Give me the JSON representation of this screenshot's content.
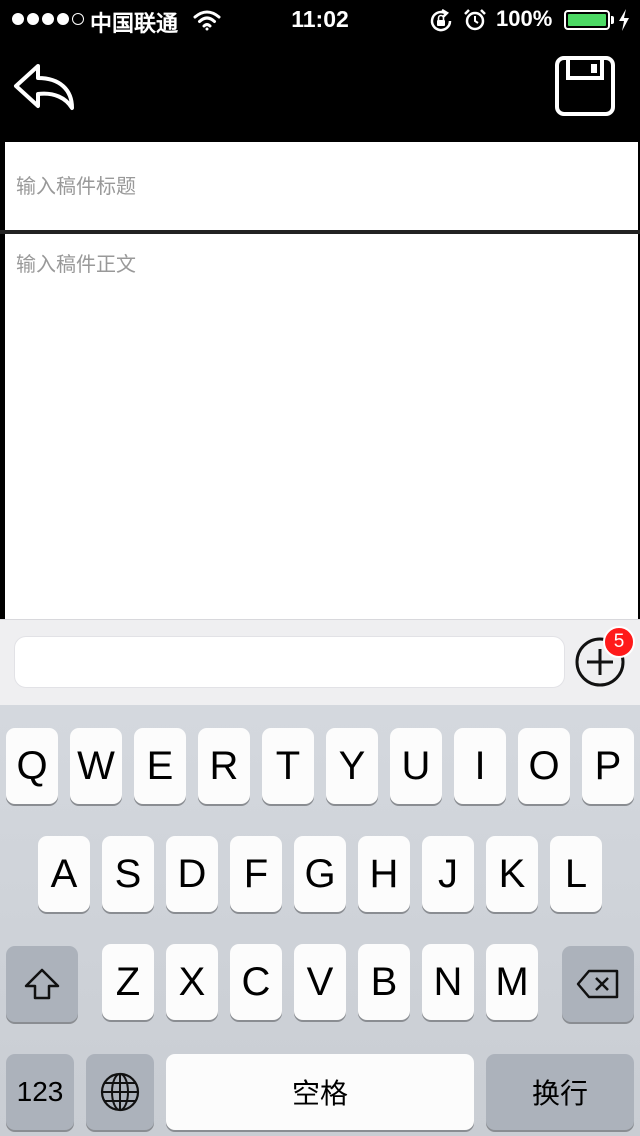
{
  "status_bar": {
    "carrier": "中国联通",
    "time": "11:02",
    "battery": "100%",
    "icons": [
      "signal-dots",
      "wifi-icon",
      "rotation-lock-icon",
      "alarm-icon",
      "battery-icon",
      "charging-bolt-icon"
    ]
  },
  "nav": {
    "back_icon": "reply-arrow-icon",
    "save_icon": "floppy-disk-icon"
  },
  "editor": {
    "title_placeholder": "输入稿件标题",
    "body_placeholder": "输入稿件正文"
  },
  "accessory": {
    "add_icon": "plus-circle-icon",
    "badge_count": "5"
  },
  "keyboard": {
    "row1": [
      "Q",
      "W",
      "E",
      "R",
      "T",
      "Y",
      "U",
      "I",
      "O",
      "P"
    ],
    "row2": [
      "A",
      "S",
      "D",
      "F",
      "G",
      "H",
      "J",
      "K",
      "L"
    ],
    "row3": [
      "Z",
      "X",
      "C",
      "V",
      "B",
      "N",
      "M"
    ],
    "numbers_label": "123",
    "space_label": "空格",
    "return_label": "换行",
    "shift_icon": "shift-icon",
    "delete_icon": "backspace-icon",
    "globe_icon": "globe-icon"
  },
  "colors": {
    "battery_fill": "#4cd964",
    "badge": "#ff1a1a"
  }
}
